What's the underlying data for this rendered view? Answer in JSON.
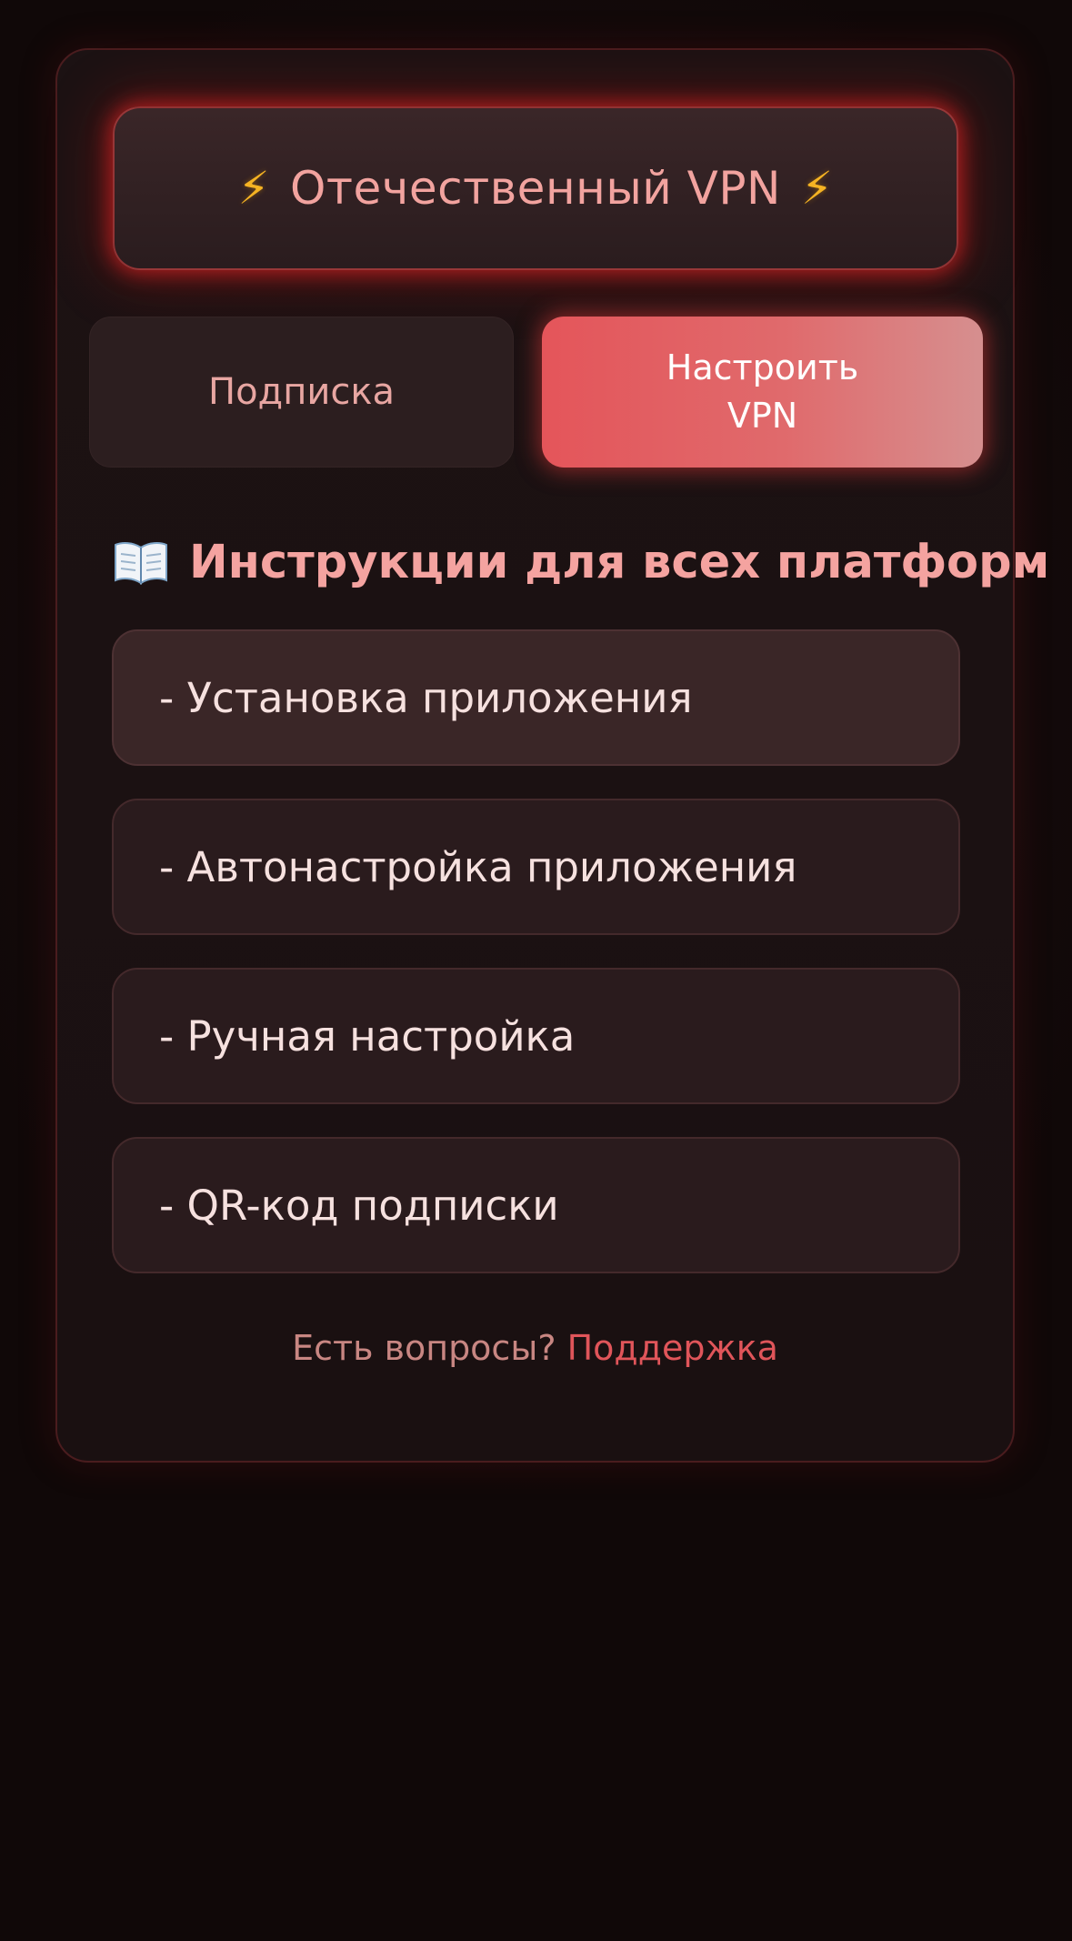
{
  "header": {
    "title": "Отечественный VPN",
    "left_icon": "lightning-icon",
    "right_icon": "lightning-icon"
  },
  "tabs": [
    {
      "label": "Подписка",
      "active": false
    },
    {
      "label": "Настроить VPN",
      "active": true
    }
  ],
  "instructions": {
    "icon": "book-icon",
    "heading": "Инструкции для всех платформ",
    "items": [
      {
        "label": "- Установка приложения"
      },
      {
        "label": "- Автонастройка приложения"
      },
      {
        "label": "- Ручная настройка"
      },
      {
        "label": "- QR-код подписки"
      }
    ]
  },
  "footer": {
    "question": "Есть вопросы?",
    "link": "Поддержка"
  },
  "colors": {
    "background": "#120909",
    "accent": "#e4555a",
    "heading": "#f4a3a0",
    "lightning": "#f5b323"
  }
}
